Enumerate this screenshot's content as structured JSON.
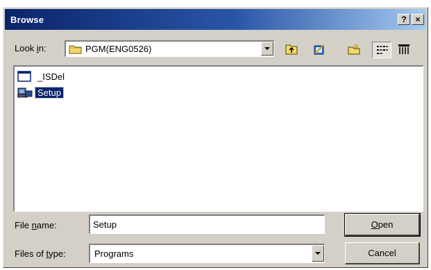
{
  "window": {
    "title": "Browse",
    "help_button": "?",
    "close_button": "×"
  },
  "look_in": {
    "label_pre": "Look ",
    "label_mnemonic": "i",
    "label_post": "n:",
    "value": "PGM(ENG0526)"
  },
  "toolbar": {
    "icons": [
      "up-one-level-icon",
      "create-new-folder-icon",
      "desktop-icon",
      "list-view-icon",
      "details-view-icon"
    ]
  },
  "files": [
    {
      "name": "_ISDel",
      "icon": "application-window-icon",
      "selected": false
    },
    {
      "name": "Setup",
      "icon": "setup-computer-icon",
      "selected": true
    }
  ],
  "file_name": {
    "label_pre": "File ",
    "label_mnemonic": "n",
    "label_post": "ame:",
    "value": "Setup"
  },
  "file_type": {
    "label_pre": "Files of ",
    "label_mnemonic": "t",
    "label_post": "ype:",
    "value": "Programs"
  },
  "buttons": {
    "open_mnemonic": "O",
    "open_rest": "pen",
    "cancel": "Cancel"
  },
  "colors": {
    "title_bar_start": "#0a246a",
    "title_bar_end": "#a6caf0",
    "face": "#d4d0c8",
    "selection": "#0a246a"
  }
}
